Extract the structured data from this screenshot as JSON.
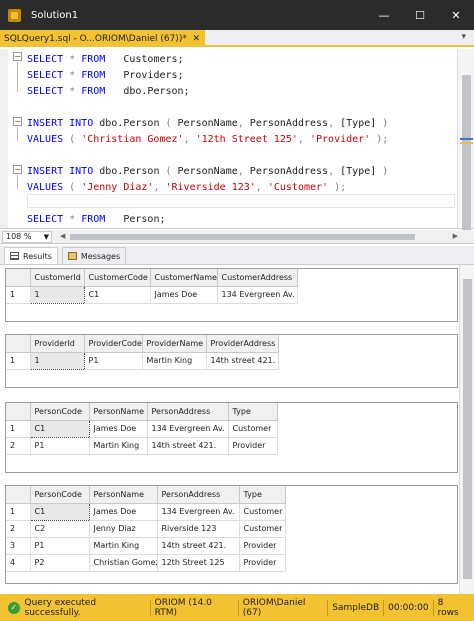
{
  "window": {
    "title": "Solution1"
  },
  "doc_tab": {
    "label": "SQLQuery1.sql - O...ORIOM\\Daniel (67))*",
    "close": "✕"
  },
  "editor": {
    "lines": [
      {
        "parts": [
          {
            "t": "SELECT",
            "c": "kw"
          },
          {
            "t": " * ",
            "c": "gr"
          },
          {
            "t": "FROM",
            "c": "kw"
          },
          {
            "t": "   Customers;",
            "c": ""
          }
        ]
      },
      {
        "parts": [
          {
            "t": "SELECT",
            "c": "kw"
          },
          {
            "t": " * ",
            "c": "gr"
          },
          {
            "t": "FROM",
            "c": "kw"
          },
          {
            "t": "   Providers;",
            "c": ""
          }
        ]
      },
      {
        "parts": [
          {
            "t": "SELECT",
            "c": "kw"
          },
          {
            "t": " * ",
            "c": "gr"
          },
          {
            "t": "FROM",
            "c": "kw"
          },
          {
            "t": "   dbo.Person;",
            "c": ""
          }
        ]
      },
      {
        "parts": []
      },
      {
        "parts": [
          {
            "t": "INSERT INTO",
            "c": "kw"
          },
          {
            "t": " dbo.Person ",
            "c": ""
          },
          {
            "t": "(",
            "c": "gr"
          },
          {
            "t": " PersonName",
            "c": ""
          },
          {
            "t": ",",
            "c": "gr"
          },
          {
            "t": " PersonAddress",
            "c": ""
          },
          {
            "t": ",",
            "c": "gr"
          },
          {
            "t": " [Type] ",
            "c": ""
          },
          {
            "t": ")",
            "c": "gr"
          }
        ]
      },
      {
        "parts": [
          {
            "t": "VALUES",
            "c": "kw"
          },
          {
            "t": " ( ",
            "c": "gr"
          },
          {
            "t": "'Christian Gomez'",
            "c": "str"
          },
          {
            "t": ", ",
            "c": "gr"
          },
          {
            "t": "'12th Street 125'",
            "c": "str"
          },
          {
            "t": ", ",
            "c": "gr"
          },
          {
            "t": "'Provider'",
            "c": "str"
          },
          {
            "t": " );",
            "c": "gr"
          }
        ]
      },
      {
        "parts": []
      },
      {
        "parts": [
          {
            "t": "INSERT INTO",
            "c": "kw"
          },
          {
            "t": " dbo.Person ",
            "c": ""
          },
          {
            "t": "(",
            "c": "gr"
          },
          {
            "t": " PersonName",
            "c": ""
          },
          {
            "t": ",",
            "c": "gr"
          },
          {
            "t": " PersonAddress",
            "c": ""
          },
          {
            "t": ",",
            "c": "gr"
          },
          {
            "t": " [Type] ",
            "c": ""
          },
          {
            "t": ")",
            "c": "gr"
          }
        ]
      },
      {
        "parts": [
          {
            "t": "VALUES",
            "c": "kw"
          },
          {
            "t": " ( ",
            "c": "gr"
          },
          {
            "t": "'Jenny Diaz'",
            "c": "str"
          },
          {
            "t": ", ",
            "c": "gr"
          },
          {
            "t": "'Riverside 123'",
            "c": "str"
          },
          {
            "t": ", ",
            "c": "gr"
          },
          {
            "t": "'Customer'",
            "c": "str"
          },
          {
            "t": " );",
            "c": "gr"
          }
        ]
      },
      {
        "parts": []
      },
      {
        "parts": [
          {
            "t": "SELECT",
            "c": "kw"
          },
          {
            "t": " * ",
            "c": "gr"
          },
          {
            "t": "FROM",
            "c": "kw"
          },
          {
            "t": "   Person;",
            "c": ""
          }
        ]
      }
    ]
  },
  "zoom": {
    "value": "108 %"
  },
  "result_tabs": {
    "results": "Results",
    "messages": "Messages"
  },
  "grids": [
    {
      "columns": [
        "CustomerId",
        "CustomerCode",
        "CustomerName",
        "CustomerAddress"
      ],
      "rows": [
        [
          "1",
          "1",
          "C1",
          "James Doe",
          "134 Evergreen Av."
        ]
      ]
    },
    {
      "columns": [
        "ProviderId",
        "ProviderCode",
        "ProviderName",
        "ProviderAddress"
      ],
      "rows": [
        [
          "1",
          "1",
          "P1",
          "Martin King",
          "14th street 421."
        ]
      ]
    },
    {
      "columns": [
        "PersonCode",
        "PersonName",
        "PersonAddress",
        "Type"
      ],
      "rows": [
        [
          "1",
          "C1",
          "James Doe",
          "134 Evergreen Av.",
          "Customer"
        ],
        [
          "2",
          "P1",
          "Martin King",
          "14th street 421.",
          "Provider"
        ]
      ]
    },
    {
      "columns": [
        "PersonCode",
        "PersonName",
        "PersonAddress",
        "Type"
      ],
      "rows": [
        [
          "1",
          "C1",
          "James Doe",
          "134 Evergreen Av.",
          "Customer"
        ],
        [
          "2",
          "C2",
          "Jenny Diaz",
          "Riverside 123",
          "Customer"
        ],
        [
          "3",
          "P1",
          "Martin King",
          "14th street 421.",
          "Provider"
        ],
        [
          "4",
          "P2",
          "Christian Gomez",
          "12th Street 125",
          "Provider"
        ]
      ]
    }
  ],
  "status": {
    "message": "Query executed successfully.",
    "server": "ORIOM (14.0 RTM)",
    "user": "ORIOM\\Daniel (67)",
    "database": "SampleDB",
    "time": "00:00:00",
    "rows": "8 rows"
  },
  "colors": {
    "accent": "#f2c233",
    "titlebar": "#2b2b2b",
    "keyword": "#0000ff",
    "string": "#d00000"
  }
}
